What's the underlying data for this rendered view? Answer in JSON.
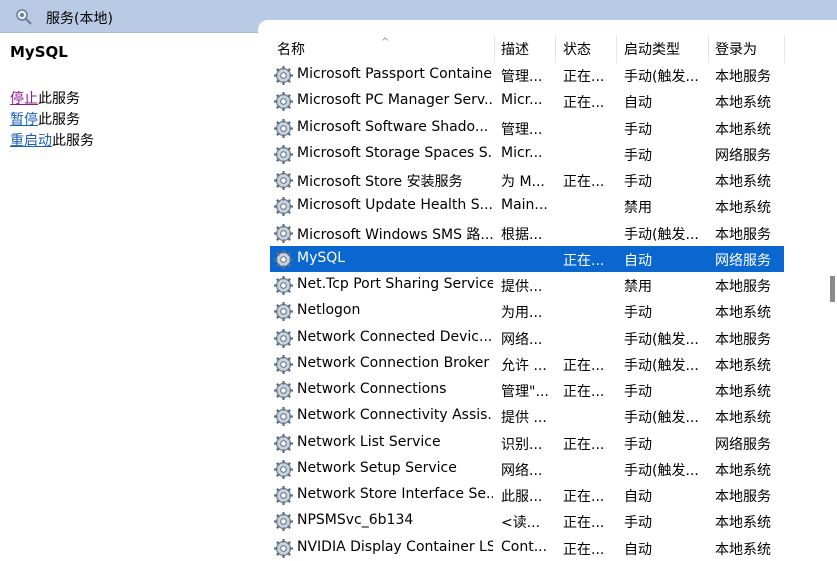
{
  "topbar": {
    "title": "服务(本地)",
    "icon": "services-icon",
    "color": "#b9cbe4"
  },
  "left_pane": {
    "service_name": "MySQL",
    "actions": [
      {
        "link": "停止",
        "rest": "此服务"
      },
      {
        "link": "暂停",
        "rest": "此服务"
      },
      {
        "link": "重启动",
        "rest": "此服务"
      }
    ]
  },
  "table": {
    "headers": {
      "name": "名称",
      "desc": "描述",
      "state": "状态",
      "start": "启动类型",
      "login": "登录为"
    },
    "rows": [
      {
        "name": "Microsoft Passport Container",
        "desc": "管理...",
        "state": "正在...",
        "start": "手动(触发...",
        "login": "本地服务"
      },
      {
        "name": "Microsoft PC Manager Serv...",
        "desc": "Micr...",
        "state": "正在...",
        "start": "自动",
        "login": "本地系统"
      },
      {
        "name": "Microsoft Software Shado...",
        "desc": "管理...",
        "state": "",
        "start": "手动",
        "login": "本地系统"
      },
      {
        "name": "Microsoft Storage Spaces S...",
        "desc": "Micr...",
        "state": "",
        "start": "手动",
        "login": "网络服务"
      },
      {
        "name": "Microsoft Store 安装服务",
        "desc": "为 M...",
        "state": "正在...",
        "start": "手动",
        "login": "本地系统"
      },
      {
        "name": "Microsoft Update Health S...",
        "desc": "Main...",
        "state": "",
        "start": "禁用",
        "login": "本地系统"
      },
      {
        "name": "Microsoft Windows SMS 路...",
        "desc": "根据...",
        "state": "",
        "start": "手动(触发...",
        "login": "本地服务"
      },
      {
        "name": "MySQL",
        "desc": "",
        "state": "正在...",
        "start": "自动",
        "login": "网络服务",
        "selected": true
      },
      {
        "name": "Net.Tcp Port Sharing Service",
        "desc": "提供...",
        "state": "",
        "start": "禁用",
        "login": "本地服务"
      },
      {
        "name": "Netlogon",
        "desc": "为用...",
        "state": "",
        "start": "手动",
        "login": "本地系统"
      },
      {
        "name": "Network Connected Devic...",
        "desc": "网络...",
        "state": "",
        "start": "手动(触发...",
        "login": "本地服务"
      },
      {
        "name": "Network Connection Broker",
        "desc": "允许 ...",
        "state": "正在...",
        "start": "手动(触发...",
        "login": "本地系统"
      },
      {
        "name": "Network Connections",
        "desc": "管理\"...",
        "state": "正在...",
        "start": "手动",
        "login": "本地系统"
      },
      {
        "name": "Network Connectivity Assis...",
        "desc": "提供 ...",
        "state": "",
        "start": "手动(触发...",
        "login": "本地系统"
      },
      {
        "name": "Network List Service",
        "desc": "识别...",
        "state": "正在...",
        "start": "手动",
        "login": "网络服务"
      },
      {
        "name": "Network Setup Service",
        "desc": "网络...",
        "state": "",
        "start": "手动(触发...",
        "login": "本地系统"
      },
      {
        "name": "Network Store Interface Se...",
        "desc": "此服...",
        "state": "正在...",
        "start": "自动",
        "login": "本地服务"
      },
      {
        "name": "NPSMSvc_6b134",
        "desc": "<读...",
        "state": "正在...",
        "start": "手动",
        "login": "本地系统"
      },
      {
        "name": "NVIDIA Display Container LS",
        "desc": "Cont...",
        "state": "正在...",
        "start": "自动",
        "login": "本地系统"
      }
    ]
  },
  "colors": {
    "selected_bg": "#0a67d0",
    "link": "#1a5fb4",
    "visited_link": "#8b1a8b"
  }
}
